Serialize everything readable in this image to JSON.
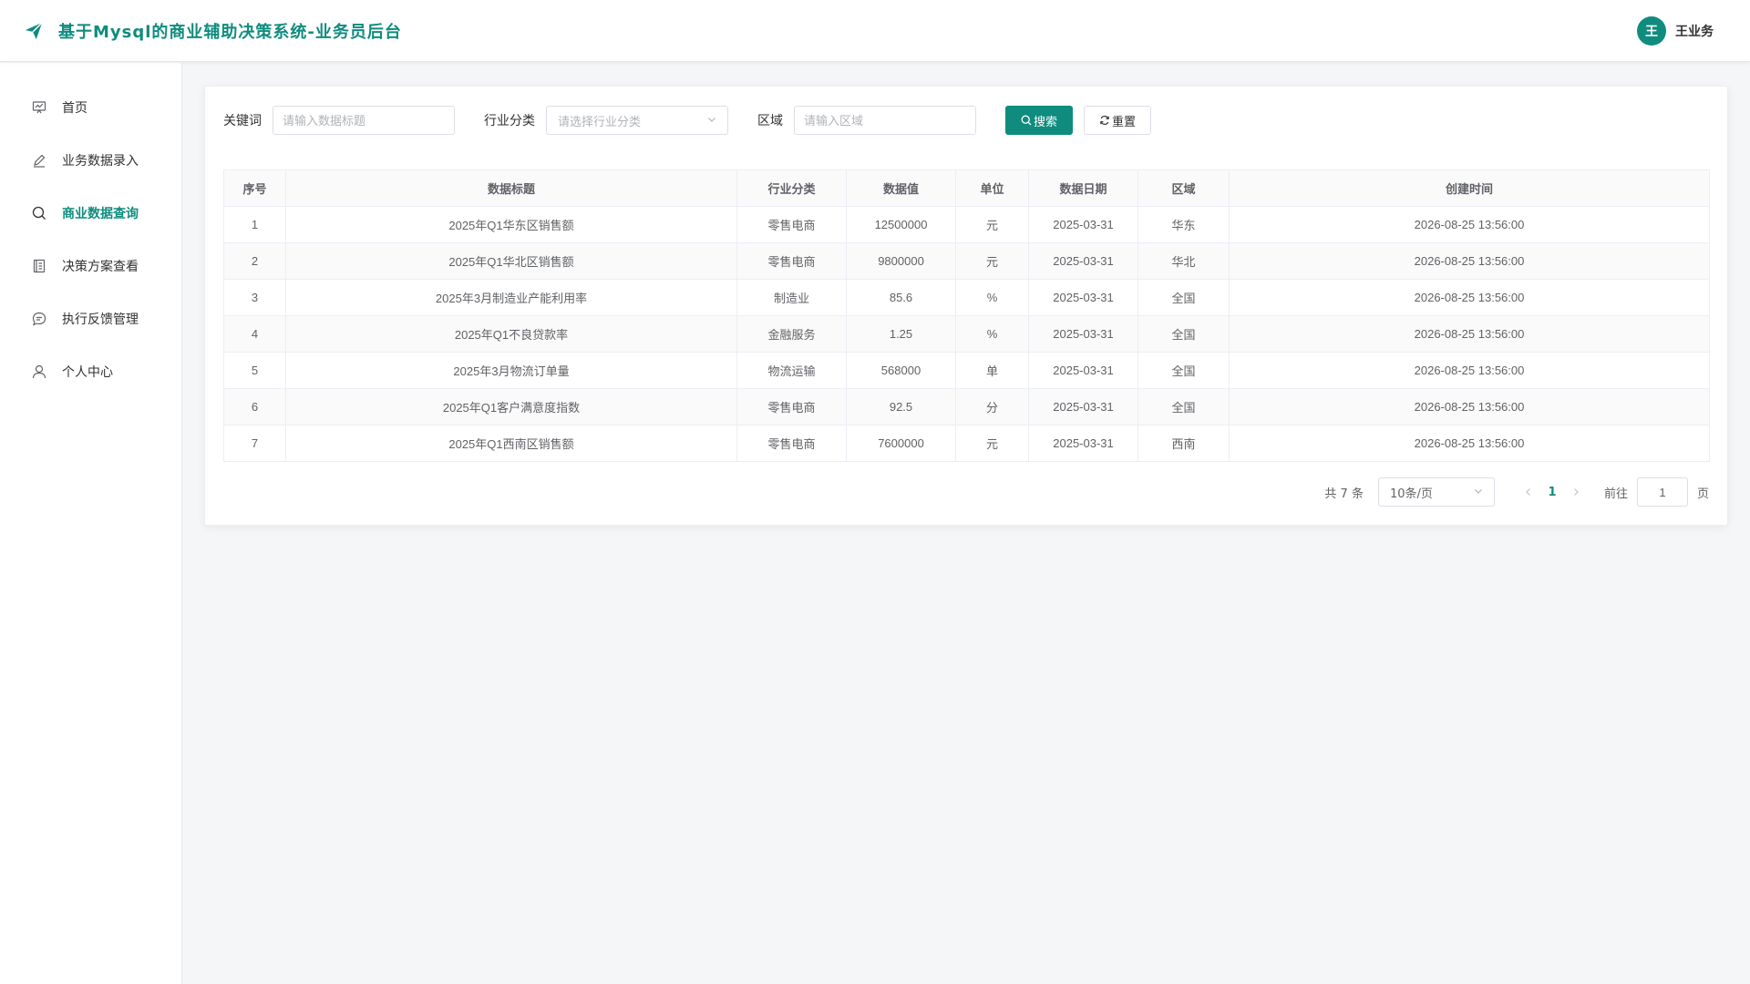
{
  "header": {
    "title": "基于Mysql的商业辅助决策系统-业务员后台",
    "avatar_text": "王",
    "user_name": "王业务",
    "brand_color": "#0f8c7e"
  },
  "sidebar": {
    "items": [
      {
        "label": "首页",
        "icon": "dashboard-icon",
        "active": false
      },
      {
        "label": "业务数据录入",
        "icon": "edit-pen-icon",
        "active": false
      },
      {
        "label": "商业数据查询",
        "icon": "search-icon",
        "active": true
      },
      {
        "label": "决策方案查看",
        "icon": "document-icon",
        "active": false
      },
      {
        "label": "执行反馈管理",
        "icon": "chat-bubble-icon",
        "active": false
      },
      {
        "label": "个人中心",
        "icon": "user-icon",
        "active": false
      }
    ]
  },
  "filters": {
    "keyword_label": "关键词",
    "keyword_placeholder": "请输入数据标题",
    "keyword_value": "",
    "industry_label": "行业分类",
    "industry_placeholder": "请选择行业分类",
    "region_label": "区域",
    "region_placeholder": "请输入区域",
    "region_value": "",
    "search_button": "搜索",
    "reset_button": "重置"
  },
  "table": {
    "columns": [
      "序号",
      "数据标题",
      "行业分类",
      "数据值",
      "单位",
      "数据日期",
      "区域",
      "创建时间"
    ],
    "rows": [
      [
        "1",
        "2025年Q1华东区销售额",
        "零售电商",
        "12500000",
        "元",
        "2025-03-31",
        "华东",
        "2026-08-25 13:56:00"
      ],
      [
        "2",
        "2025年Q1华北区销售额",
        "零售电商",
        "9800000",
        "元",
        "2025-03-31",
        "华北",
        "2026-08-25 13:56:00"
      ],
      [
        "3",
        "2025年3月制造业产能利用率",
        "制造业",
        "85.6",
        "%",
        "2025-03-31",
        "全国",
        "2026-08-25 13:56:00"
      ],
      [
        "4",
        "2025年Q1不良贷款率",
        "金融服务",
        "1.25",
        "%",
        "2025-03-31",
        "全国",
        "2026-08-25 13:56:00"
      ],
      [
        "5",
        "2025年3月物流订单量",
        "物流运输",
        "568000",
        "单",
        "2025-03-31",
        "全国",
        "2026-08-25 13:56:00"
      ],
      [
        "6",
        "2025年Q1客户满意度指数",
        "零售电商",
        "92.5",
        "分",
        "2025-03-31",
        "全国",
        "2026-08-25 13:56:00"
      ],
      [
        "7",
        "2025年Q1西南区销售额",
        "零售电商",
        "7600000",
        "元",
        "2025-03-31",
        "西南",
        "2026-08-25 13:56:00"
      ]
    ]
  },
  "pagination": {
    "total_text": "共 7 条",
    "page_size": "10条/页",
    "current_page": "1",
    "goto_label": "前往",
    "goto_value": "1",
    "page_suffix": "页"
  }
}
